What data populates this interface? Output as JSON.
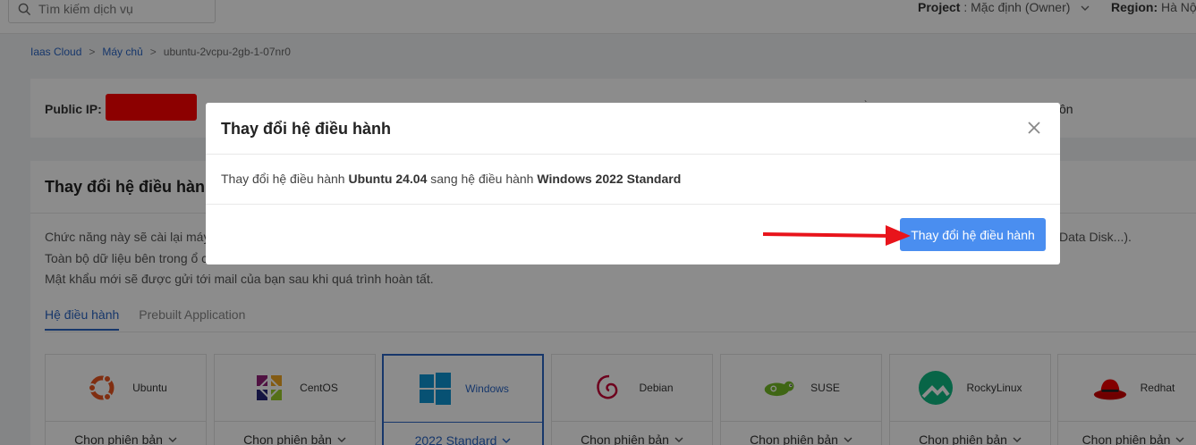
{
  "topbar": {
    "search_placeholder": "Tìm kiếm dịch vụ",
    "project_label": "Project",
    "project_value": " : Mặc định (Owner)",
    "region_label": "Region:",
    "region_value": " Hà Nội"
  },
  "breadcrumb": {
    "items": [
      "Iaas Cloud",
      "Máy chủ",
      "ubuntu-2vcpu-2gb-1-07nr0"
    ],
    "separator": ">"
  },
  "server_card": {
    "public_ip_label": "Public IP:",
    "tail_text": "ôn",
    "tick_text": "`"
  },
  "os_section": {
    "heading": "Thay đổi hệ điều hành",
    "desc_lines": [
      "Chức năng này sẽ cài lại máy",
      "Toàn bộ dữ liệu bên trong ổ c",
      "Mật khẩu mới sẽ được gửi tới mail của bạn sau khi quá trình hoàn tất."
    ],
    "desc_tail": "Data Disk...).",
    "tabs": [
      "Hệ điều hành",
      "Prebuilt Application"
    ],
    "os_list": [
      {
        "name": "Ubuntu",
        "version": "Chọn phiên bản",
        "icon": "ubuntu-icon"
      },
      {
        "name": "CentOS",
        "version": "Chọn phiên bản",
        "icon": "centos-icon"
      },
      {
        "name": "Windows",
        "version": "2022 Standard",
        "icon": "windows-icon"
      },
      {
        "name": "Debian",
        "version": "Chọn phiên bản",
        "icon": "debian-icon"
      },
      {
        "name": "SUSE",
        "version": "Chọn phiên bản",
        "icon": "suse-icon"
      },
      {
        "name": "RockyLinux",
        "version": "Chọn phiên bản",
        "icon": "rockylinux-icon"
      },
      {
        "name": "Redhat",
        "version": "Chọn phiên bản",
        "icon": "redhat-icon"
      }
    ]
  },
  "modal": {
    "title": "Thay đổi hệ điều hành",
    "body_prefix": "Thay đổi hệ điều hành ",
    "from_os": "Ubuntu 24.04",
    "body_middle": " sang hệ điều hành ",
    "to_os": "Windows 2022 Standard",
    "confirm_label": "Thay đổi hệ điều hành"
  },
  "colors": {
    "accent": "#2a65c4",
    "button": "#4a8ef0",
    "annotation_arrow": "#e8141b",
    "redaction": "#ff0000"
  }
}
